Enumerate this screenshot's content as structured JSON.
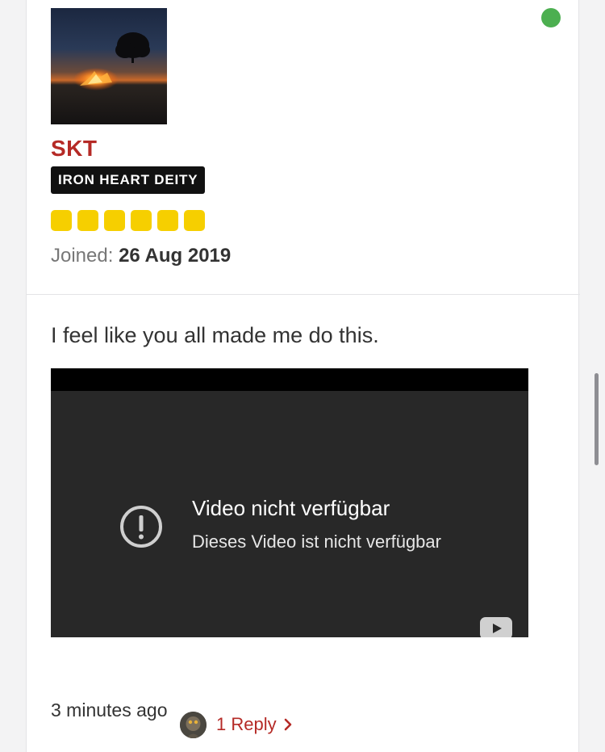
{
  "profile": {
    "username": "SKT",
    "rank": "IRON HEART DEITY",
    "rank_pips": 6,
    "joined_label": "Joined:",
    "joined_date": "26 Aug 2019",
    "online": true
  },
  "post": {
    "text": "I feel like you all made me do this.",
    "timestamp": "3 minutes ago",
    "reply_label": "1 Reply"
  },
  "video": {
    "title": "Video nicht verfügbar",
    "subtitle": "Dieses Video ist nicht verfügbar"
  },
  "colors": {
    "username": "#b52a26",
    "online_dot": "#4caf50",
    "rank_pip": "#f6cf00",
    "rank_badge_bg": "#111111",
    "link": "#b52a26"
  },
  "icons": [
    "online-status-icon",
    "warning-icon",
    "youtube-logo-icon",
    "chevron-right-icon"
  ]
}
